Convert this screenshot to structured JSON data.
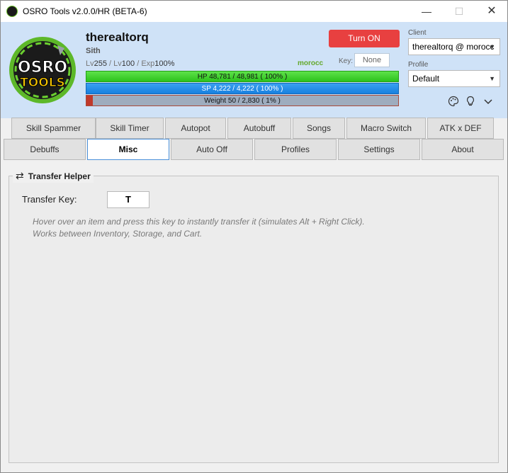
{
  "window": {
    "title": "OSRO Tools v2.0.0/HR (BETA-6)",
    "min_symbol": "—",
    "max_symbol": "☐",
    "close_symbol": "✕"
  },
  "character": {
    "name": "therealtorq",
    "job": "Sith",
    "lv_label": "Lv",
    "base_level": "255",
    "sep": " / ",
    "job_lv_label": "Lv",
    "job_level": "100",
    "exp_label": "Exp",
    "exp": "100%",
    "server": "morocc"
  },
  "toggle": {
    "label": "Turn ON",
    "color": "#e84040"
  },
  "key": {
    "label": "Key:",
    "value": "None"
  },
  "bars": {
    "hp_text": "HP  48,781  /  48,981  ( 100% )",
    "sp_text": "SP  4,222  /  4,222  ( 100% )",
    "weight_text": "Weight  50  /  2,830  ( 1% )",
    "weight_fraction": 0.02
  },
  "client": {
    "label": "Client",
    "value": "therealtorq @ morocc"
  },
  "profile": {
    "label": "Profile",
    "value": "Default"
  },
  "header_icons": [
    "palette-icon",
    "lightbulb-icon",
    "chevron-down-icon"
  ],
  "tabs_row1": [
    "Skill Spammer",
    "Skill Timer",
    "Autopot",
    "Autobuff",
    "Songs",
    "Macro Switch",
    "ATK x DEF"
  ],
  "tabs_row2": [
    "Debuffs",
    "Misc",
    "Auto Off",
    "Profiles",
    "Settings",
    "About"
  ],
  "active_tab": "Misc",
  "transfer": {
    "legend": "Transfer Helper",
    "key_label": "Transfer Key:",
    "key_value": "T",
    "desc_line1": "Hover over an item and press this key to instantly transfer it (simulates Alt + Right Click).",
    "desc_line2": "Works between Inventory, Storage, and Cart."
  }
}
